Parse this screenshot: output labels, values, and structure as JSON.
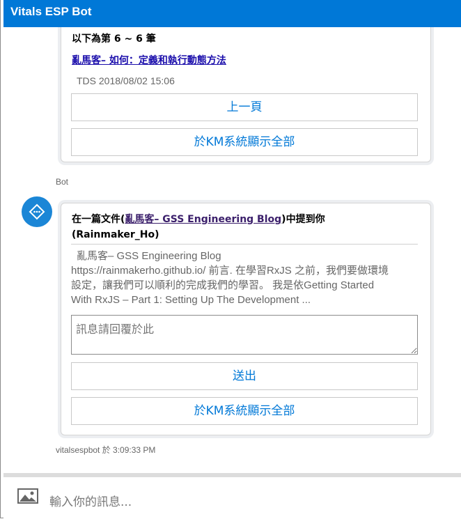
{
  "header": {
    "title": "Vitals ESP Bot"
  },
  "card1": {
    "heading": "以下為第 6 ~ 6 筆",
    "link_text": "亂馬客– 如何：定義和執行動態方法",
    "meta": "TDS  2018/08/02 15:06",
    "prev_button": "上一頁",
    "km_button": "於KM系統顯示全部"
  },
  "sender_label": "Bot",
  "card2": {
    "title_prefix": "在一篇文件(",
    "title_link": "亂馬客– GSS Engineering Blog",
    "title_suffix": ")中提到你",
    "title_line2": "(Rainmaker_Ho)",
    "snippet_line1": "亂馬客– GSS Engineering Blog",
    "snippet_line2": "https://rainmakerho.github.io/ 前言. 在學習RxJS 之前，我們要做環境",
    "snippet_line3": "設定，讓我們可以順利的完成我們的學習。 我是依Getting Started",
    "snippet_line4": "With RxJS – Part 1: Setting Up The Development ...",
    "reply_placeholder": "訊息請回覆於此",
    "send_button": "送出",
    "km_button": "於KM系統顯示全部"
  },
  "timestamp": "vitalsespbot 於 3:09:33 PM",
  "input": {
    "placeholder": "輸入你的訊息..."
  },
  "icons": {
    "avatar": "bot-diamond-icon",
    "image": "image-upload-icon"
  },
  "colors": {
    "accent": "#0078d7",
    "avatar": "#1b86d6"
  }
}
